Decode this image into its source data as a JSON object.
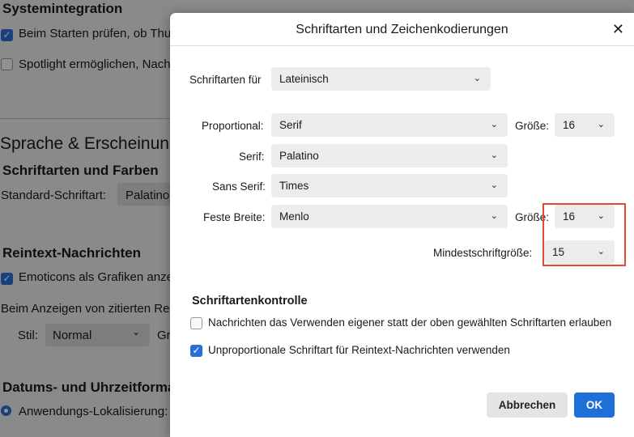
{
  "background": {
    "system_integration_heading": "Systemintegration",
    "check_startup": "Beim Starten prüfen, ob Thu",
    "spotlight": "Spotlight ermöglichen, Nach",
    "language_heading": "Sprache & Erscheinung",
    "fonts_colors_heading": "Schriftarten und Farben",
    "default_font_label": "Standard-Schriftart:",
    "default_font_value": "Palatino",
    "plaintext_heading": "Reintext-Nachrichten",
    "emoticons": "Emoticons als Grafiken anze",
    "quote_display": "Beim Anzeigen von zitierten Re",
    "style_label": "Stil:",
    "style_value": "Normal",
    "style_trailing": "Gr",
    "date_time_heading": "Datums- und Uhrzeitforma",
    "app_locale": "Anwendungs-Lokalisierung:"
  },
  "dialog": {
    "title": "Schriftarten und Zeichenkodierungen",
    "close_glyph": "✕",
    "fonts_for_label": "Schriftarten für",
    "fonts_for_value": "Lateinisch",
    "proportional_label": "Proportional:",
    "proportional_value": "Serif",
    "size_label": "Größe:",
    "proportional_size": "16",
    "serif_label": "Serif:",
    "serif_value": "Palatino",
    "sans_label": "Sans Serif:",
    "sans_value": "Times",
    "mono_label": "Feste Breite:",
    "mono_value": "Menlo",
    "mono_size_label": "Größe:",
    "mono_size": "16",
    "min_size_label": "Mindestschriftgröße:",
    "min_size": "15",
    "font_control_heading": "Schriftartenkontrolle",
    "allow_own_fonts": "Nachrichten das Verwenden eigener statt der oben gewählten Schriftarten erlauben",
    "monospace_plaintext": "Unproportionale Schriftart für Reintext-Nachrichten verwenden",
    "cancel": "Abbrechen",
    "ok": "OK",
    "chevron": "⌄"
  },
  "colors": {
    "accent": "#1f6fd9",
    "highlight": "#e0493a"
  }
}
